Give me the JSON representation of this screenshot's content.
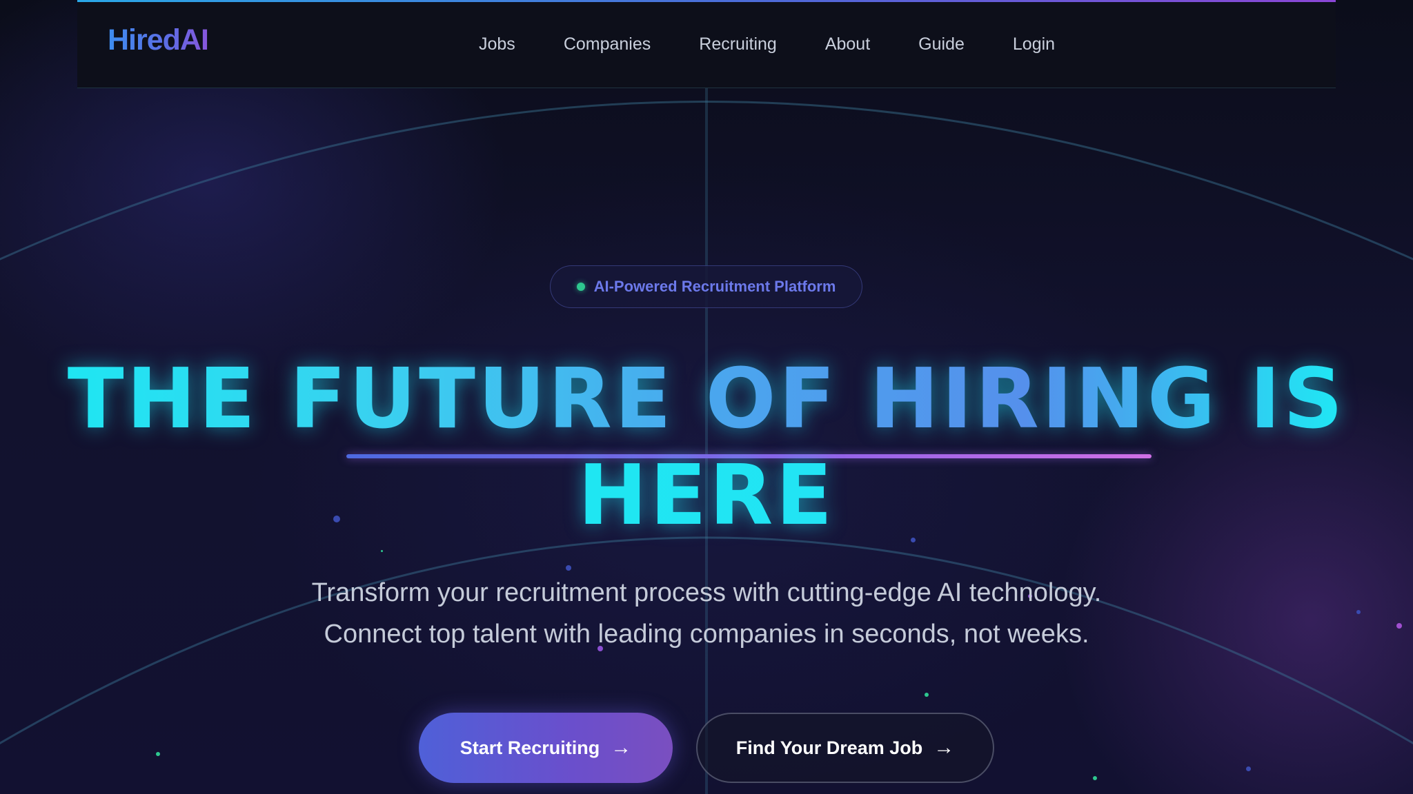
{
  "header": {
    "logo": "HiredAI",
    "nav": [
      "Jobs",
      "Companies",
      "Recruiting",
      "About",
      "Guide",
      "Login"
    ]
  },
  "hero": {
    "badge": "AI-Powered Recruitment Platform",
    "headline_line1": "THE FUTURE OF HIRING IS",
    "headline_line2": "HERE",
    "subtitle_line1": "Transform your recruitment process with cutting-edge AI technology.",
    "subtitle_line2": "Connect top talent with leading companies in seconds, not weeks.",
    "primary_button": "Start Recruiting",
    "secondary_button": "Find Your Dream Job",
    "arrow_icon": "→"
  },
  "colors": {
    "accent_cyan": "#1fe6f2",
    "accent_indigo": "#5b63de",
    "accent_purple": "#8b46d6",
    "badge_dot": "#2ec78f",
    "background": "#0d0f1f"
  }
}
